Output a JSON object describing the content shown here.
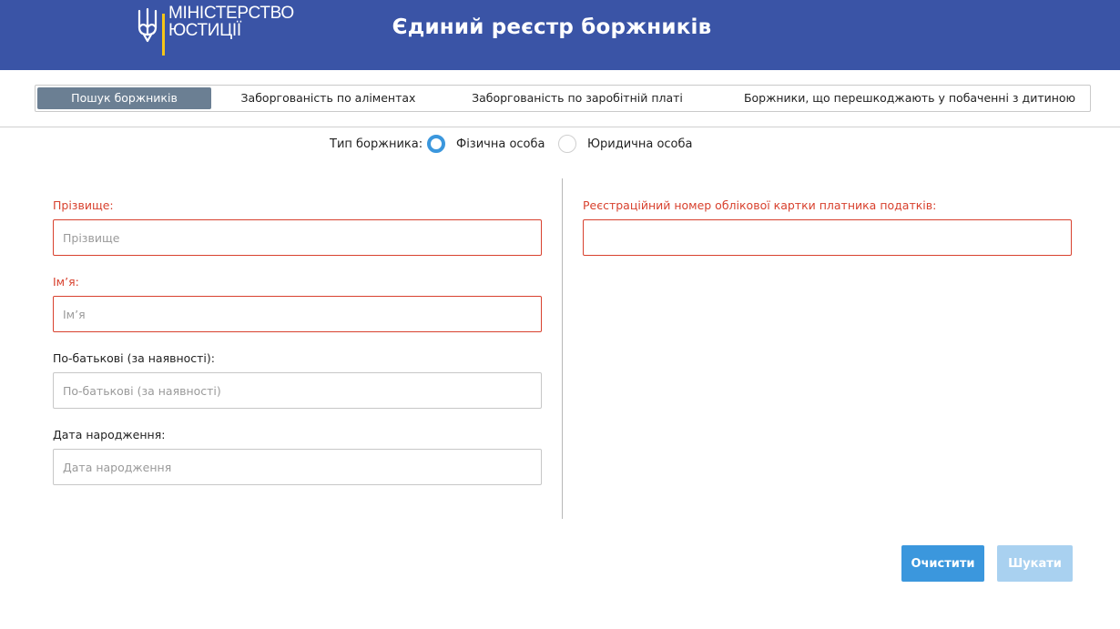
{
  "header": {
    "logo_line1": "МІНІСТЕРСТВО",
    "logo_line2": "ЮСТИЦІЇ",
    "title": "Єдиний реєстр боржників",
    "background_color": "#3a54a6",
    "accent_color": "#f5c518"
  },
  "tabs": [
    {
      "label": "Пошук боржників",
      "active": true
    },
    {
      "label": "Заборгованість по аліментах",
      "active": false
    },
    {
      "label": "Заборгованість по заробітній платі",
      "active": false
    },
    {
      "label": "Боржники, що перешкоджають у побаченні з дитиною",
      "active": false
    }
  ],
  "debtor_type": {
    "label": "Тип боржника:",
    "options": [
      {
        "label": "Фізична особа",
        "selected": true
      },
      {
        "label": "Юридична особа",
        "selected": false
      }
    ]
  },
  "form": {
    "left": [
      {
        "label": "Прізвище:",
        "placeholder": "Прізвище",
        "value": "",
        "required": true
      },
      {
        "label": "Ім’я:",
        "placeholder": "Ім’я",
        "value": "",
        "required": true
      },
      {
        "label": "По-батькові (за наявності):",
        "placeholder": "По-батькові (за наявності)",
        "value": "",
        "required": false
      },
      {
        "label": "Дата народження:",
        "placeholder": "Дата народження",
        "value": "",
        "required": false
      }
    ],
    "right": [
      {
        "label": "Реєстраційний номер облікової картки платника податків:",
        "placeholder": "",
        "value": "",
        "required": true
      }
    ]
  },
  "buttons": {
    "clear_label": "Очистити",
    "search_label": "Шукати"
  },
  "colors": {
    "required": "#d8412e",
    "primary": "#3b97dd",
    "primary_disabled": "#a9d1f0",
    "tab_active": "#6b7f93"
  },
  "icons": {
    "logo": "trident-icon"
  }
}
